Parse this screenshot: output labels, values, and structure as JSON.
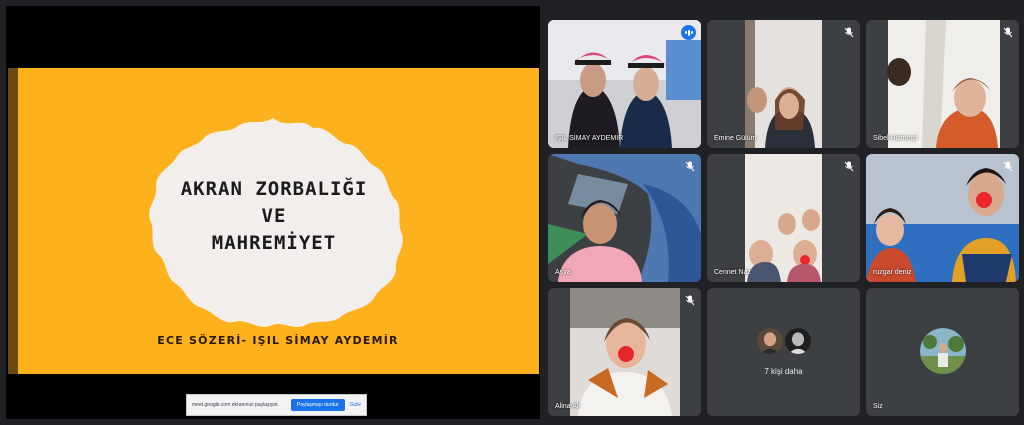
{
  "presentation": {
    "slide_title_lines": [
      "AKRAN ZORBALIĞI",
      "VE",
      "MAHREMİYET"
    ],
    "slide_subtitle": "ECE SÖZERİ- IŞIL SİMAY AYDEMİR",
    "colors": {
      "slide_bg": "#FDB21D",
      "badge": "#F1EEEB"
    }
  },
  "share_bar": {
    "text": "meet.google.com ekranınızı paylaşıyor.",
    "stop_label": "Paylaşmayı durdur",
    "hide_label": "Gizle"
  },
  "participants": [
    {
      "name": "IŞIL SİMAY AYDEMİR",
      "state": "speaking"
    },
    {
      "name": "Emine Gülüm",
      "state": "muted"
    },
    {
      "name": "Sibel Hizmetçi",
      "state": "muted"
    },
    {
      "name": "Asya",
      "state": "muted"
    },
    {
      "name": "Cennet Naz",
      "state": "muted"
    },
    {
      "name": "ruzgar deniz",
      "state": "muted"
    },
    {
      "name": "Alina Ali",
      "state": "muted"
    }
  ],
  "more_tile": {
    "label": "7 kişi daha"
  },
  "self_tile": {
    "name": "Siz"
  },
  "theme": {
    "accent": "#1a73e8",
    "tile_bg": "#3c4043",
    "page_bg": "#202124"
  }
}
